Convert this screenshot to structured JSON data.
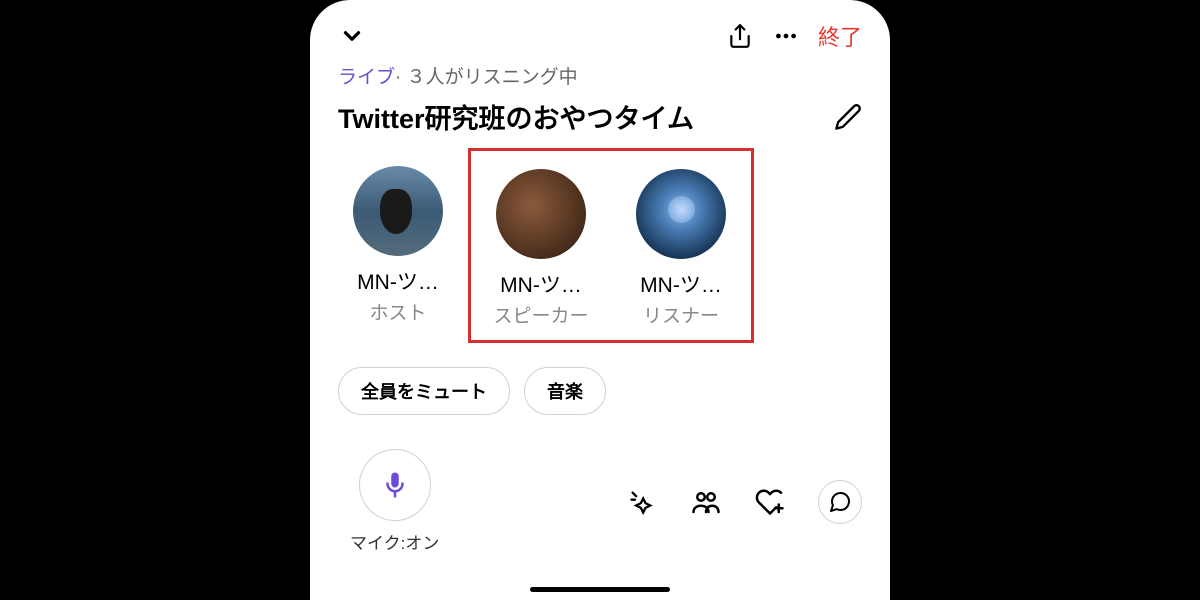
{
  "header": {
    "end_label": "終了"
  },
  "status": {
    "live_label": "ライブ",
    "separator": "·",
    "listening_text": "３人がリスニング中"
  },
  "space": {
    "title": "Twitter研究班のおやつタイム"
  },
  "participants": [
    {
      "name": "MN-ツ…",
      "role": "ホスト",
      "avatar_type": "penguin"
    },
    {
      "name": "MN-ツ…",
      "role": "スピーカー",
      "avatar_type": "crab"
    },
    {
      "name": "MN-ツ…",
      "role": "リスナー",
      "avatar_type": "jellyfish"
    }
  ],
  "actions": {
    "mute_all": "全員をミュート",
    "music": "音楽"
  },
  "mic": {
    "status_label": "マイク:オン"
  },
  "colors": {
    "live": "#6b4ed4",
    "end": "#e53935",
    "highlight": "#d32f2f",
    "mic_icon": "#6b4ed4"
  }
}
